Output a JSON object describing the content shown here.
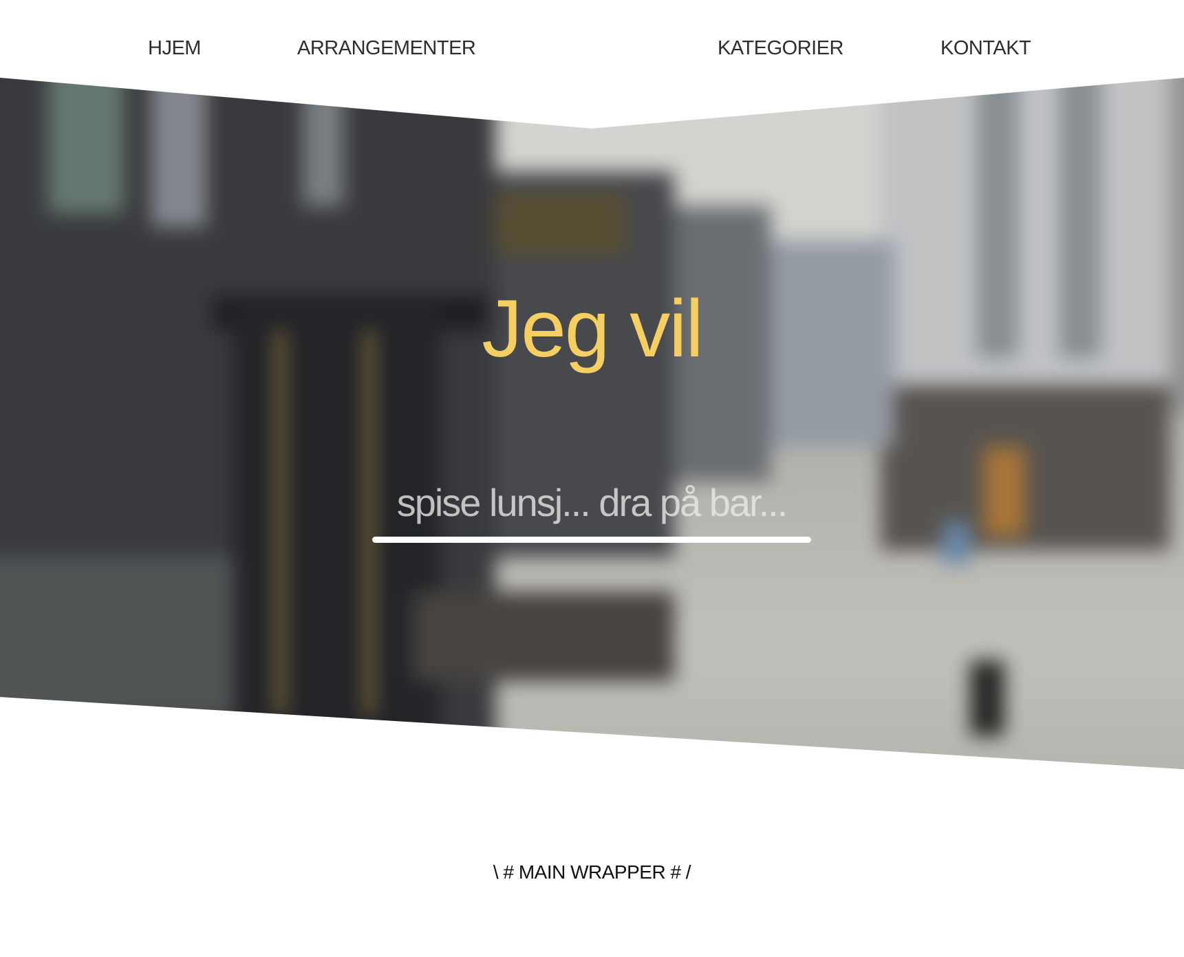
{
  "nav": {
    "items": [
      {
        "label": "HJEM"
      },
      {
        "label": "ARRANGEMENTER"
      },
      {
        "label": "KATEGORIER"
      },
      {
        "label": "KONTAKT"
      }
    ]
  },
  "hero": {
    "title": "Jeg vil",
    "search_placeholder": "spise lunsj... dra på bar...",
    "title_color": "#f6cf63",
    "background": "blurred city street photo"
  },
  "main": {
    "placeholder_text": "\\ # MAIN WRAPPER # /"
  }
}
